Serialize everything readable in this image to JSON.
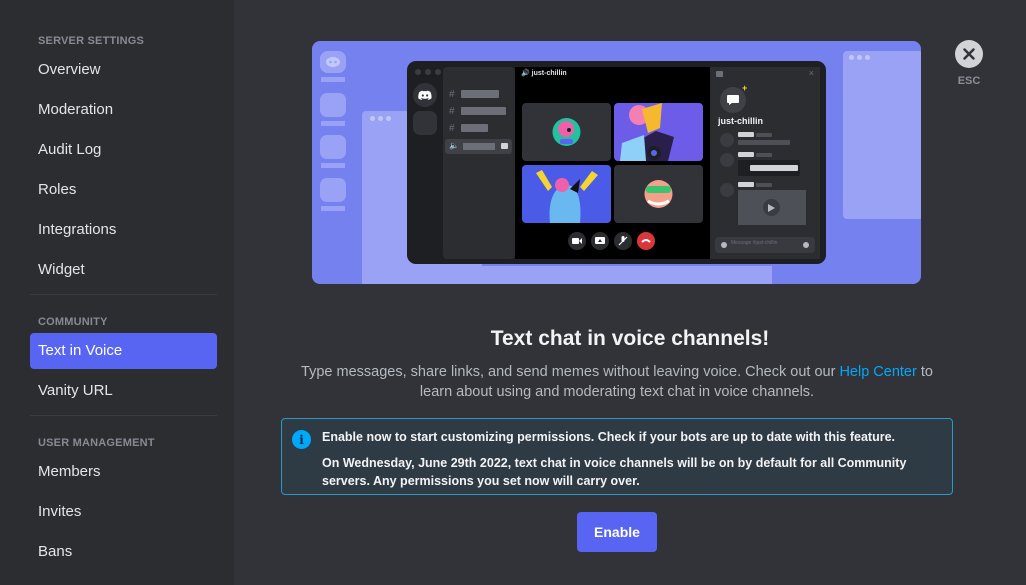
{
  "sidebar": {
    "sections": [
      {
        "header": "SERVER SETTINGS",
        "items": [
          "Overview",
          "Moderation",
          "Audit Log",
          "Roles",
          "Integrations",
          "Widget"
        ]
      },
      {
        "header": "COMMUNITY",
        "items": [
          "Text in Voice",
          "Vanity URL"
        ]
      },
      {
        "header": "USER MANAGEMENT",
        "items": [
          "Members",
          "Invites",
          "Bans"
        ]
      }
    ],
    "active_item": "Text in Voice"
  },
  "close": {
    "label": "ESC",
    "icon": "close-icon"
  },
  "illustration": {
    "voice_channel_name": "just-chillin",
    "thread_title": "just-chillin",
    "message_placeholder": "Message #just-chillin",
    "controls": [
      "camera-icon",
      "screen-share-icon",
      "mute-icon",
      "hang-up-icon"
    ]
  },
  "main": {
    "heading": "Text chat in voice channels!",
    "description_before": "Type messages, share links, and send memes without leaving voice. Check out our ",
    "help_link": "Help Center",
    "description_after": " to learn about using and moderating text chat in voice channels.",
    "notice": {
      "line1": "Enable now to start customizing permissions. Check if your bots are up to date with this feature.",
      "line2": "On Wednesday, June 29th 2022, text chat in voice channels will be on by default for all Community servers. Any permissions you set now will carry over."
    },
    "enable_label": "Enable"
  },
  "colors": {
    "accent": "#5865f2",
    "link": "#00a8fc",
    "sidebar_bg": "#2b2d31",
    "main_bg": "#313338"
  }
}
